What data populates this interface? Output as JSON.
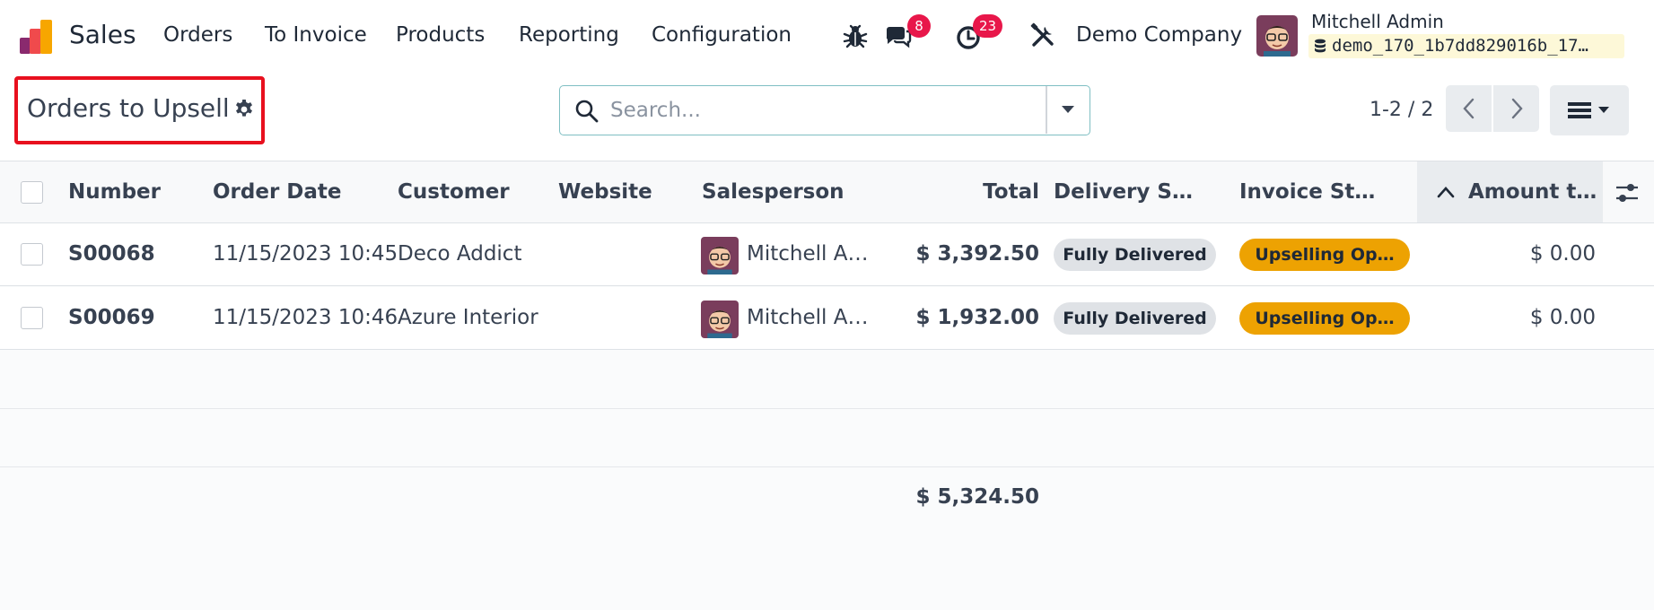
{
  "nav": {
    "app_name": "Sales",
    "menu": [
      "Orders",
      "To Invoice",
      "Products",
      "Reporting",
      "Configuration"
    ],
    "messages_badge": "8",
    "activities_badge": "23",
    "company": "Demo Company",
    "user_name": "Mitchell Admin",
    "database": "demo_170_1b7dd829016b_17…",
    "brand_colors": {
      "accent": "#e8174a",
      "logo_red": "#f04a4c",
      "logo_orange": "#f7a600",
      "logo_purple": "#8a2a6e"
    }
  },
  "control_panel": {
    "title": "Orders to Upsell",
    "search_placeholder": "Search...",
    "pager": "1-2 / 2"
  },
  "list": {
    "columns": [
      "Number",
      "Order Date",
      "Customer",
      "Website",
      "Salesperson",
      "Total",
      "Delivery S…",
      "Invoice St…",
      "Amount t…"
    ],
    "rows": [
      {
        "number": "S00068",
        "order_date": "11/15/2023 10:45",
        "customer": "Deco Addict",
        "website": "",
        "salesperson": "Mitchell A…",
        "total": "$ 3,392.50",
        "delivery_status": "Fully Delivered",
        "invoice_status": "Upselling Op…",
        "amount": "$ 0.00"
      },
      {
        "number": "S00069",
        "order_date": "11/15/2023 10:46",
        "customer": "Azure Interior",
        "website": "",
        "salesperson": "Mitchell A…",
        "total": "$ 1,932.00",
        "delivery_status": "Fully Delivered",
        "invoice_status": "Upselling Op…",
        "amount": "$ 0.00"
      }
    ],
    "total_sum": "$ 5,324.50",
    "status_colors": {
      "delivered": "#dfe2e6",
      "upselling": "#eda202"
    }
  }
}
